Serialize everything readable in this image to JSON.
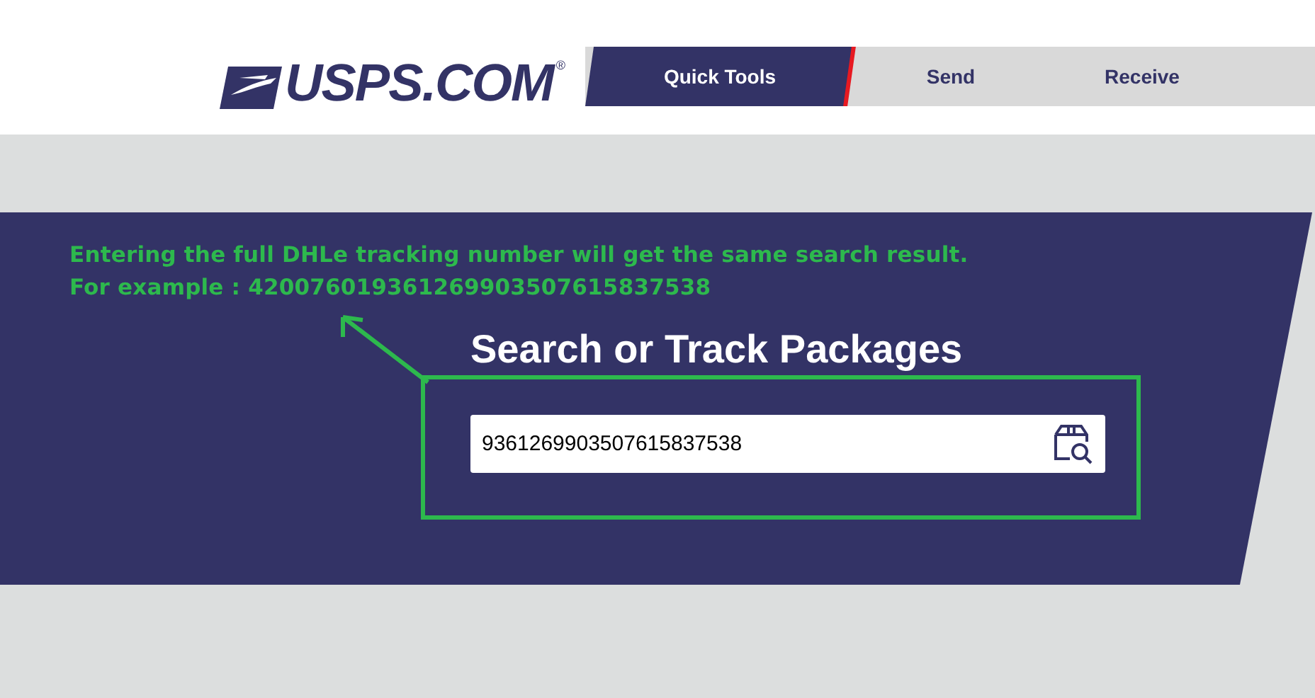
{
  "header": {
    "logo": {
      "text": "USPS.COM",
      "mark": "®"
    },
    "tabs": [
      {
        "label": "Quick Tools",
        "selected": true
      },
      {
        "label": "Send",
        "selected": false
      },
      {
        "label": "Receive",
        "selected": false
      }
    ]
  },
  "annotation": {
    "lines": [
      "Entering the full DHLe tracking number will get the same search result.",
      "For example : 420076019361269903507615837538"
    ]
  },
  "search": {
    "title": "Search or Track Packages",
    "value": "9361269903507615837538"
  }
}
